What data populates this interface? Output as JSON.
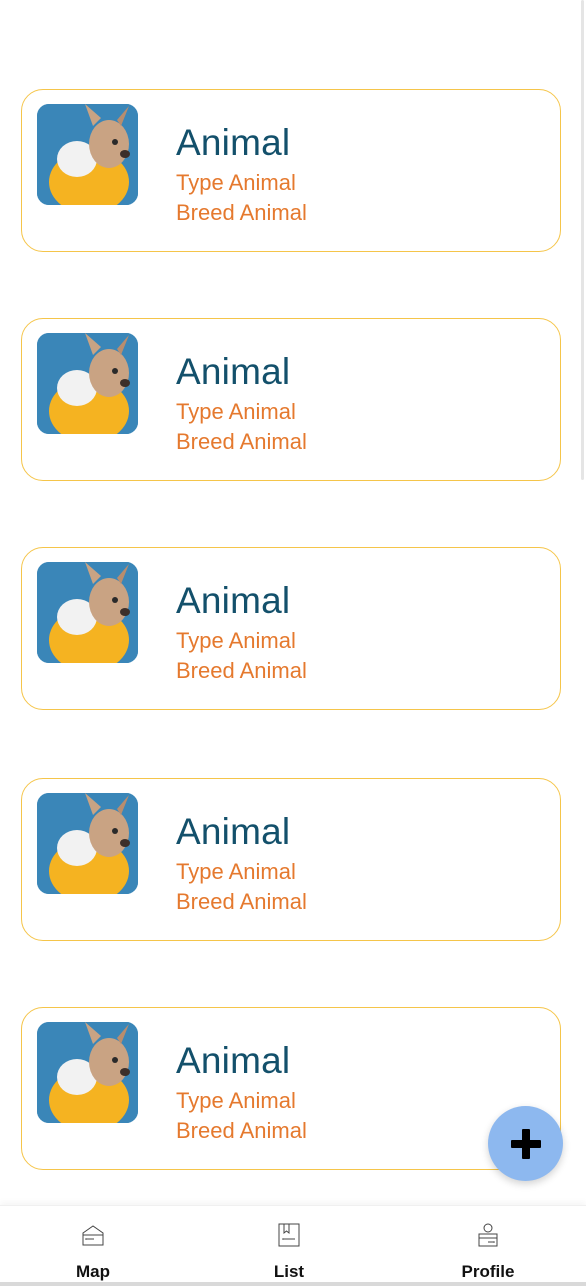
{
  "animals": [
    {
      "name": "Animal",
      "type": "Type Animal",
      "breed": "Breed Animal"
    },
    {
      "name": "Animal",
      "type": "Type Animal",
      "breed": "Breed Animal"
    },
    {
      "name": "Animal",
      "type": "Type Animal",
      "breed": "Breed Animal"
    },
    {
      "name": "Animal",
      "type": "Type Animal",
      "breed": "Breed Animal"
    },
    {
      "name": "Animal",
      "type": "Type Animal",
      "breed": "Breed Animal"
    }
  ],
  "fab": {
    "icon": "plus-icon"
  },
  "nav": {
    "items": [
      {
        "label": "Map",
        "icon": "map-icon"
      },
      {
        "label": "List",
        "icon": "list-icon"
      },
      {
        "label": "Profile",
        "icon": "profile-icon"
      }
    ]
  },
  "colors": {
    "card_border": "#f5c54a",
    "title": "#13506b",
    "subtitle": "#e5792e",
    "fab": "#8db8ef"
  }
}
